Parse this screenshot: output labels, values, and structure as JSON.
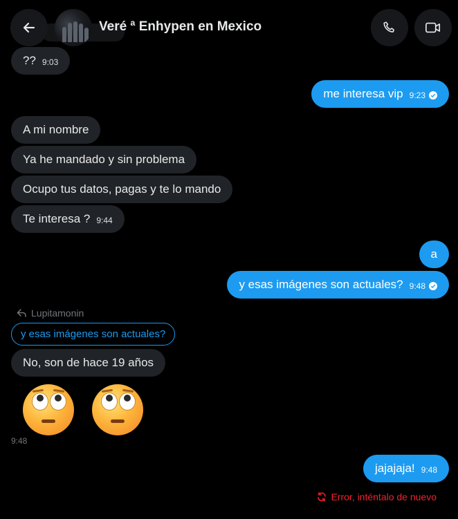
{
  "header": {
    "title": "Veré ª Enhypen en Mexico",
    "back_icon": "arrow-left-icon",
    "call_icon": "phone-icon",
    "video_icon": "video-camera-icon"
  },
  "messages": {
    "m1": {
      "text": "??",
      "time": "9:03"
    },
    "m2": {
      "text": "me interesa vip",
      "time": "9:23"
    },
    "m3": {
      "text": "A mi nombre"
    },
    "m4": {
      "text": "Ya he mandado y sin problema"
    },
    "m5": {
      "text": "Ocupo tus datos, pagas y te lo mando"
    },
    "m6": {
      "text": "Te interesa ?",
      "time": "9:44"
    },
    "m7": {
      "text": "a"
    },
    "m8": {
      "text": "y esas imágenes son actuales?",
      "time": "9:48"
    },
    "reply": {
      "author": "Lupitamonin",
      "quoted": "y esas imágenes son actuales?"
    },
    "m9": {
      "text": "No, son de hace 19 años"
    },
    "emoji_time": "9:48",
    "m10": {
      "text": "jajajaja!",
      "time": "9:48"
    }
  },
  "status": {
    "error_text": "Error, inténtalo de nuevo",
    "error_color": "#f4212e"
  },
  "colors": {
    "outgoing": "#1d9bf0",
    "incoming": "#202327",
    "background": "#000000"
  }
}
